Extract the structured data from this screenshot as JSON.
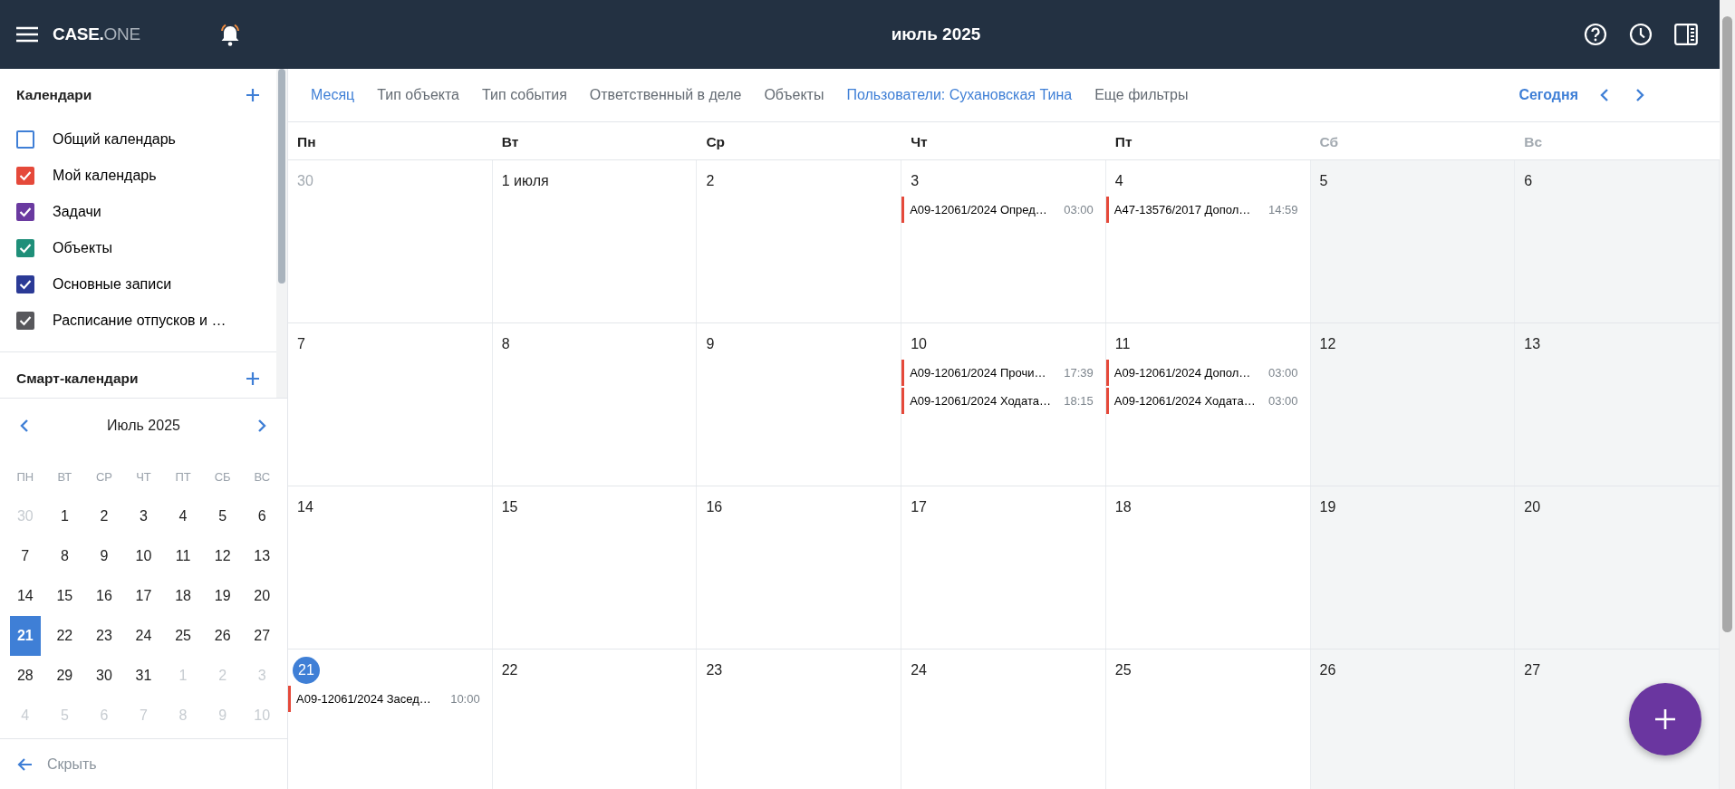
{
  "header": {
    "logo": {
      "primary": "CASE.",
      "secondary": "ONE"
    },
    "title": "июль 2025"
  },
  "sidebar": {
    "calendars": {
      "title": "Календари",
      "items": [
        {
          "label": "Общий календарь",
          "checked": false,
          "color": "#3f7fd6"
        },
        {
          "label": "Мой календарь",
          "checked": true,
          "color": "#e5493a"
        },
        {
          "label": "Задачи",
          "checked": true,
          "color": "#6a3aa0"
        },
        {
          "label": "Объекты",
          "checked": true,
          "color": "#1f8f79"
        },
        {
          "label": "Основные записи",
          "checked": true,
          "color": "#2b3a96"
        },
        {
          "label": "Расписание отпусков и …",
          "checked": true,
          "color": "#58585c"
        }
      ]
    },
    "smart_calendars": {
      "title": "Смарт-календари"
    },
    "mini_calendar": {
      "title": "Июль 2025",
      "weekdays": [
        "ПН",
        "ВТ",
        "СР",
        "ЧТ",
        "ПТ",
        "СБ",
        "ВС"
      ],
      "weeks": [
        [
          {
            "label": "30",
            "muted": true,
            "selected": false
          },
          {
            "label": "1",
            "muted": false,
            "selected": false
          },
          {
            "label": "2",
            "muted": false,
            "selected": false
          },
          {
            "label": "3",
            "muted": false,
            "selected": false
          },
          {
            "label": "4",
            "muted": false,
            "selected": false
          },
          {
            "label": "5",
            "muted": false,
            "selected": false
          },
          {
            "label": "6",
            "muted": false,
            "selected": false
          }
        ],
        [
          {
            "label": "7",
            "muted": false,
            "selected": false
          },
          {
            "label": "8",
            "muted": false,
            "selected": false
          },
          {
            "label": "9",
            "muted": false,
            "selected": false
          },
          {
            "label": "10",
            "muted": false,
            "selected": false
          },
          {
            "label": "11",
            "muted": false,
            "selected": false
          },
          {
            "label": "12",
            "muted": false,
            "selected": false
          },
          {
            "label": "13",
            "muted": false,
            "selected": false
          }
        ],
        [
          {
            "label": "14",
            "muted": false,
            "selected": false
          },
          {
            "label": "15",
            "muted": false,
            "selected": false
          },
          {
            "label": "16",
            "muted": false,
            "selected": false
          },
          {
            "label": "17",
            "muted": false,
            "selected": false
          },
          {
            "label": "18",
            "muted": false,
            "selected": false
          },
          {
            "label": "19",
            "muted": false,
            "selected": false
          },
          {
            "label": "20",
            "muted": false,
            "selected": false
          }
        ],
        [
          {
            "label": "21",
            "muted": false,
            "selected": true
          },
          {
            "label": "22",
            "muted": false,
            "selected": false
          },
          {
            "label": "23",
            "muted": false,
            "selected": false
          },
          {
            "label": "24",
            "muted": false,
            "selected": false
          },
          {
            "label": "25",
            "muted": false,
            "selected": false
          },
          {
            "label": "26",
            "muted": false,
            "selected": false
          },
          {
            "label": "27",
            "muted": false,
            "selected": false
          }
        ],
        [
          {
            "label": "28",
            "muted": false,
            "selected": false
          },
          {
            "label": "29",
            "muted": false,
            "selected": false
          },
          {
            "label": "30",
            "muted": false,
            "selected": false
          },
          {
            "label": "31",
            "muted": false,
            "selected": false
          },
          {
            "label": "1",
            "muted": true,
            "selected": false
          },
          {
            "label": "2",
            "muted": true,
            "selected": false
          },
          {
            "label": "3",
            "muted": true,
            "selected": false
          }
        ],
        [
          {
            "label": "4",
            "muted": true,
            "selected": false
          },
          {
            "label": "5",
            "muted": true,
            "selected": false
          },
          {
            "label": "6",
            "muted": true,
            "selected": false
          },
          {
            "label": "7",
            "muted": true,
            "selected": false
          },
          {
            "label": "8",
            "muted": true,
            "selected": false
          },
          {
            "label": "9",
            "muted": true,
            "selected": false
          },
          {
            "label": "10",
            "muted": true,
            "selected": false
          }
        ]
      ]
    },
    "hide_label": "Скрыть"
  },
  "filters": [
    {
      "label": "Месяц",
      "active": true
    },
    {
      "label": "Тип объекта",
      "active": false
    },
    {
      "label": "Тип события",
      "active": false
    },
    {
      "label": "Ответственный в деле",
      "active": false
    },
    {
      "label": "Объекты",
      "active": false
    },
    {
      "label": "Пользователи: Сухановская Тина",
      "active": true
    },
    {
      "label": "Еще фильтры",
      "active": false
    }
  ],
  "today_button": "Сегодня",
  "calendar": {
    "weekdays": [
      {
        "label": "Пн",
        "weekend": false
      },
      {
        "label": "Вт",
        "weekend": false
      },
      {
        "label": "Ср",
        "weekend": false
      },
      {
        "label": "Чт",
        "weekend": false
      },
      {
        "label": "Пт",
        "weekend": false
      },
      {
        "label": "Сб",
        "weekend": true
      },
      {
        "label": "Вс",
        "weekend": true
      }
    ],
    "weeks": [
      [
        {
          "label": "30",
          "muted": true,
          "today": false
        },
        {
          "label": "1 июля",
          "muted": false,
          "today": false
        },
        {
          "label": "2",
          "muted": false,
          "today": false
        },
        {
          "label": "3",
          "muted": false,
          "today": false,
          "events": [
            {
              "title": "A09-12061/2024 Опред…",
              "time": "03:00"
            }
          ]
        },
        {
          "label": "4",
          "muted": false,
          "today": false,
          "events": [
            {
              "title": "A47-13576/2017 Допол…",
              "time": "14:59"
            }
          ]
        },
        {
          "label": "5",
          "muted": false,
          "today": false
        },
        {
          "label": "6",
          "muted": false,
          "today": false
        }
      ],
      [
        {
          "label": "7",
          "muted": false,
          "today": false
        },
        {
          "label": "8",
          "muted": false,
          "today": false
        },
        {
          "label": "9",
          "muted": false,
          "today": false
        },
        {
          "label": "10",
          "muted": false,
          "today": false,
          "events": [
            {
              "title": "A09-12061/2024 Прочи…",
              "time": "17:39"
            },
            {
              "title": "A09-12061/2024 Ходата…",
              "time": "18:15"
            }
          ]
        },
        {
          "label": "11",
          "muted": false,
          "today": false,
          "events": [
            {
              "title": "A09-12061/2024 Допол…",
              "time": "03:00"
            },
            {
              "title": "A09-12061/2024 Ходата…",
              "time": "03:00"
            }
          ]
        },
        {
          "label": "12",
          "muted": false,
          "today": false
        },
        {
          "label": "13",
          "muted": false,
          "today": false
        }
      ],
      [
        {
          "label": "14",
          "muted": false,
          "today": false
        },
        {
          "label": "15",
          "muted": false,
          "today": false
        },
        {
          "label": "16",
          "muted": false,
          "today": false
        },
        {
          "label": "17",
          "muted": false,
          "today": false
        },
        {
          "label": "18",
          "muted": false,
          "today": false
        },
        {
          "label": "19",
          "muted": false,
          "today": false
        },
        {
          "label": "20",
          "muted": false,
          "today": false
        }
      ],
      [
        {
          "label": "21",
          "muted": false,
          "today": true,
          "events": [
            {
              "title": "A09-12061/2024 Засед…",
              "time": "10:00"
            }
          ]
        },
        {
          "label": "22",
          "muted": false,
          "today": false
        },
        {
          "label": "23",
          "muted": false,
          "today": false
        },
        {
          "label": "24",
          "muted": false,
          "today": false
        },
        {
          "label": "25",
          "muted": false,
          "today": false
        },
        {
          "label": "26",
          "muted": false,
          "today": false
        },
        {
          "label": "27",
          "muted": false,
          "today": false
        }
      ]
    ]
  }
}
